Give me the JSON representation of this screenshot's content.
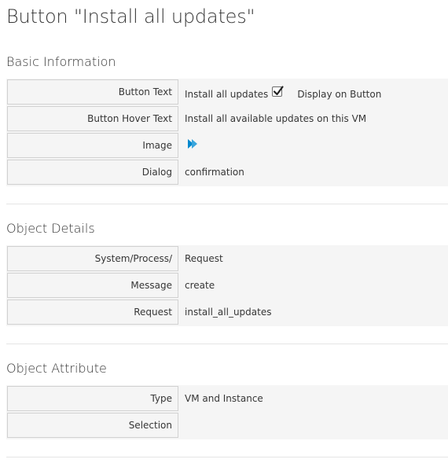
{
  "page": {
    "title": "Button \"Install all updates\""
  },
  "basic_information": {
    "heading": "Basic Information",
    "rows": [
      {
        "label": "Button Text",
        "value": "Install all updates",
        "checkbox_label": "Display on Button",
        "checkbox_checked": true
      },
      {
        "label": "Button Hover Text",
        "value": "Install all available updates on this VM"
      },
      {
        "label": "Image",
        "icon": "double-play-arrow-icon",
        "icon_color": "#0088ce"
      },
      {
        "label": "Dialog",
        "value": "confirmation"
      }
    ]
  },
  "object_details": {
    "heading": "Object Details",
    "rows": [
      {
        "label": "System/Process/",
        "value": "Request"
      },
      {
        "label": "Message",
        "value": "create"
      },
      {
        "label": "Request",
        "value": "install_all_updates"
      }
    ]
  },
  "object_attribute": {
    "heading": "Object Attribute",
    "rows": [
      {
        "label": "Type",
        "value": "VM and Instance"
      },
      {
        "label": "Selection",
        "value": ""
      }
    ]
  }
}
